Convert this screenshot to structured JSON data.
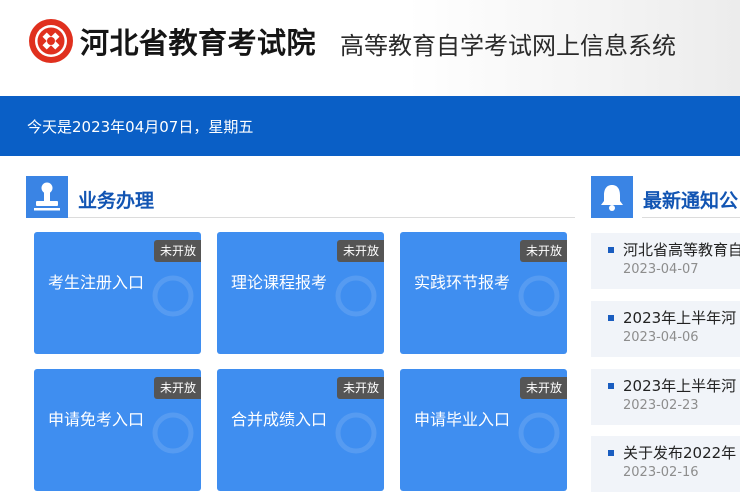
{
  "header": {
    "org_name": "河北省教育考试院",
    "system_name": "高等教育自学考试网上信息系统",
    "logo_icon": "exam-seal-logo-icon",
    "brand_color": "#e0301e"
  },
  "datebar": {
    "date_text": "今天是2023年04月07日，星期五",
    "color": "#0a5fc6"
  },
  "business": {
    "title": "业务办理",
    "icon": "stamp-icon",
    "tiles": [
      {
        "label": "考生注册入口",
        "badge": "未开放"
      },
      {
        "label": "理论课程报考",
        "badge": "未开放"
      },
      {
        "label": "实践环节报考",
        "badge": "未开放"
      },
      {
        "label": "申请免考入口",
        "badge": "未开放"
      },
      {
        "label": "合并成绩入口",
        "badge": "未开放"
      },
      {
        "label": "申请毕业入口",
        "badge": "未开放"
      }
    ]
  },
  "notices": {
    "title": "最新通知公",
    "icon": "bell-icon",
    "items": [
      {
        "title": "河北省高等教育自",
        "date": "2023-04-07"
      },
      {
        "title": "2023年上半年河",
        "date": "2023-04-06"
      },
      {
        "title": "2023年上半年河",
        "date": "2023-02-23"
      },
      {
        "title": "关于发布2022年",
        "date": "2023-02-16"
      }
    ]
  }
}
